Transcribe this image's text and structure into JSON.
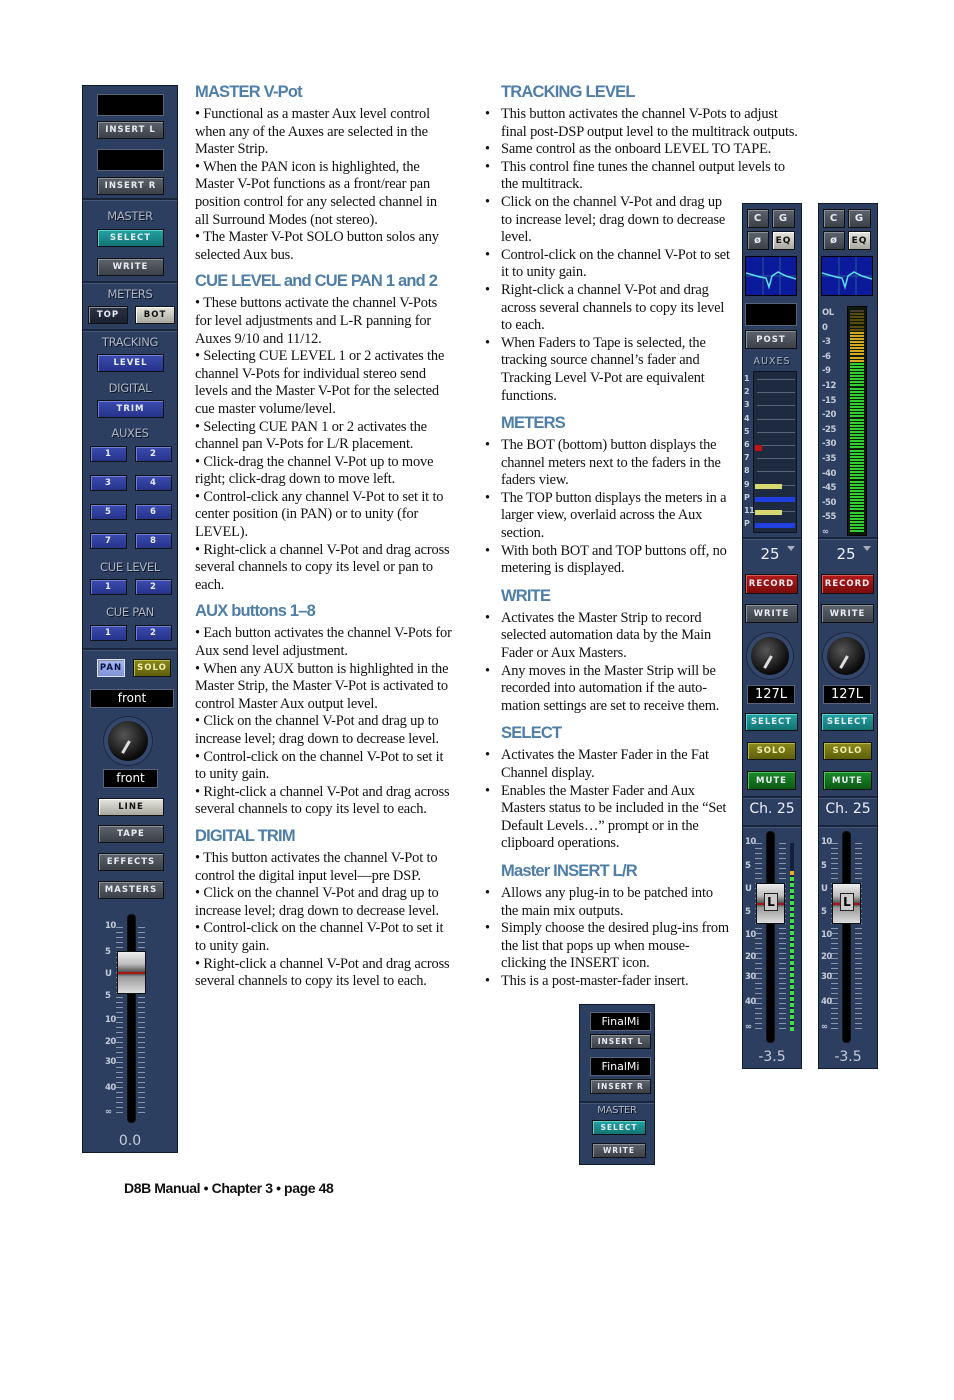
{
  "left_column": [
    {
      "heading": "MASTER V-Pot",
      "items": [
        "Functional as a master Aux level control when any of the Auxes are selected in the Master Strip.",
        "When the PAN icon is highlighted, the Master V-Pot functions as a front/rear pan position control for any selected channel in all Surround Modes (not stereo).",
        "The Master V-Pot SOLO button solos any selected Aux bus."
      ]
    },
    {
      "heading": "CUE LEVEL and CUE PAN 1 and 2",
      "items": [
        "These buttons activate the channel V-Pots for level adjustments and L-R panning for Auxes 9/10 and 11/12.",
        "Selecting CUE LEVEL 1 or 2 activates the channel V-Pots for individual stereo send levels and the Master V-Pot for the selected cue master volume/level.",
        "Selecting CUE PAN 1 or 2 activates the channel pan V-Pots for L/R placement.",
        "Click-drag the channel V-Pot up to move right; click-drag down to move left.",
        "Control-click any channel V-Pot to set it to center position (in PAN) or to unity (for LEVEL).",
        "Right-click a channel V-Pot and drag across several channels to copy its level or pan to each."
      ]
    },
    {
      "heading": "AUX buttons 1–8",
      "items": [
        "Each button activates the channel V-Pots for Aux send level adjustment.",
        "When any AUX button is highlighted in the Master Strip, the Master V-Pot is activated to control Master Aux output level.",
        "Click on the channel V-Pot and drag up to increase level; drag down to decrease level.",
        "Control-click on the channel V-Pot to set it to unity gain.",
        "Right-click a channel V-Pot and drag across several channels to copy its level to each."
      ]
    },
    {
      "heading": "DIGITAL TRIM",
      "items": [
        "This button activates the channel V-Pot to control the digital input level—pre DSP.",
        "Click on the channel V-Pot and drag up to increase level; drag down to decrease level.",
        "Control-click on the channel V-Pot to set it to unity gain.",
        "Right-click a channel V-Pot and drag across several channels to copy its level to each."
      ]
    }
  ],
  "right_column": [
    {
      "heading": "TRACKING LEVEL",
      "items": [
        "This button activates the channel V-Pots to adjust final post-DSP output level to the multitrack outputs.",
        "Same control as the onboard LEVEL TO TAPE.",
        "This control fine tunes the channel output levels to the multitrack.",
        "Click on the channel V-Pot and drag up to increase level; drag down to decrease level.",
        "Control-click on the channel V-Pot to set it to unity gain.",
        "Right-click a channel V-Pot and drag across several channels to copy its level to each.",
        "When Faders to Tape is selected, the tracking source channel’s fader and Tracking Level V-Pot are equivalent functions."
      ]
    },
    {
      "heading": "METERS",
      "items": [
        "The BOT (bottom) button displays the channel meters next to the faders in the faders view.",
        "The TOP button displays the meters in a larger view, overlaid across the Aux section.",
        "With both BOT and TOP buttons off, no metering is displayed."
      ]
    },
    {
      "heading": "WRITE",
      "items": [
        "Activates the Master Strip to record selected automation data by the Main Fader or Aux Masters.",
        "Any moves in the Master Strip will be recorded into automation if the auto-mation settings are set to receive them."
      ]
    },
    {
      "heading": "SELECT",
      "items": [
        "Activates the Master Fader in the Fat Channel display.",
        "Enables the Master Fader and Aux Masters status to be included in the “Set Default Levels…” prompt or in the clipboard operations."
      ]
    },
    {
      "heading": "Master INSERT L/R",
      "items": [
        "Allows any plug-in to be patched into the main mix outputs.",
        "Simply choose the desired plug-ins from the list that pops up when mouse-clicking the INSERT icon.",
        "This is a post-master-fader insert."
      ]
    }
  ],
  "master_strip": {
    "insert_l": "INSERT L",
    "insert_r": "INSERT R",
    "master_label": "MASTER",
    "select": "SELECT",
    "write": "WRITE",
    "meters_label": "METERS",
    "top": "TOP",
    "bot": "BOT",
    "tracking_label": "TRACKING",
    "level": "LEVEL",
    "digital_label": "DIGITAL",
    "trim": "TRIM",
    "auxes_label": "AUXES",
    "aux_buttons": [
      "1",
      "2",
      "3",
      "4",
      "5",
      "6",
      "7",
      "8"
    ],
    "cue_level_label": "CUE LEVEL",
    "cue_level_buttons": [
      "1",
      "2"
    ],
    "cue_pan_label": "CUE PAN",
    "cue_pan_buttons": [
      "1",
      "2"
    ],
    "pan": "PAN",
    "solo": "SOLO",
    "pan_mode": "front",
    "pot_value": "front",
    "sources": [
      "LINE",
      "TAPE",
      "EFFECTS",
      "MASTERS"
    ],
    "fader_scale": [
      "10",
      "5",
      "U",
      "5",
      "10",
      "20",
      "30",
      "40",
      "∞"
    ],
    "fader_value": "0.0"
  },
  "channel_strips": [
    {
      "c": "C",
      "g": "G",
      "phase": "ø",
      "eq": "EQ",
      "post": "POST",
      "auxes_label": "AUXES",
      "aux_labels": [
        "1",
        "2",
        "3",
        "4",
        "5",
        "6",
        "7",
        "8",
        "9",
        "P",
        "11",
        "P"
      ],
      "number": "25",
      "record": "RECORD",
      "write": "WRITE",
      "pan_value": "127L",
      "select": "SELECT",
      "solo": "SOLO",
      "mute": "MUTE",
      "name": "Ch. 25",
      "fader_cap": "L",
      "fader_value": "-3.5"
    },
    {
      "c": "C",
      "g": "G",
      "phase": "ø",
      "eq": "EQ",
      "meter_scale": [
        "OL",
        "0",
        "-3",
        "-6",
        "-9",
        "-12",
        "-15",
        "-20",
        "-25",
        "-30",
        "-35",
        "-40",
        "-45",
        "-50",
        "-55",
        "∞"
      ],
      "number": "25",
      "record": "RECORD",
      "write": "WRITE",
      "pan_value": "127L",
      "select": "SELECT",
      "solo": "SOLO",
      "mute": "MUTE",
      "name": "Ch. 25",
      "fader_cap": "L",
      "fader_value": "-3.5"
    }
  ],
  "fader_scale": [
    "10",
    "5",
    "U",
    "5",
    "10",
    "20",
    "30",
    "40",
    "∞"
  ],
  "mini_strip": {
    "insert_l_plugin": "FinalMi",
    "insert_l": "INSERT L",
    "insert_r_plugin": "FinalMi",
    "insert_r": "INSERT R",
    "master_label": "MASTER",
    "select": "SELECT",
    "write": "WRITE"
  },
  "colors": {
    "heading": "#4f7ea6",
    "panel": "#2d3f60",
    "select": "#1a8a8a",
    "solo": "#6b6b10",
    "mute": "#0e6a1a",
    "record": "#8a1010",
    "aux": "#2a3a9a"
  },
  "footer": "D8B Manual • Chapter 3 • page  48"
}
